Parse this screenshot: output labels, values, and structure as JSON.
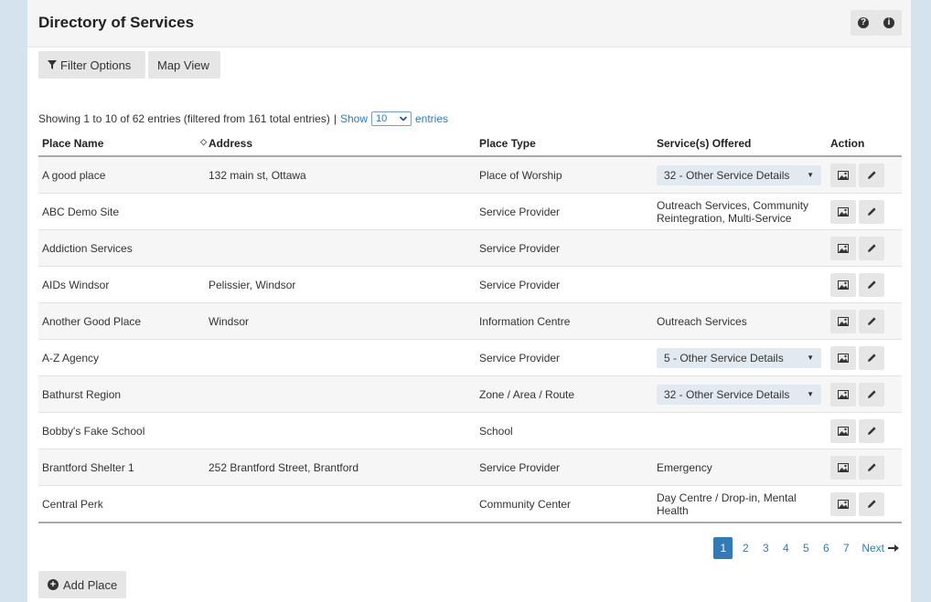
{
  "header": {
    "title": "Directory of Services",
    "help_glyph": "?",
    "info_glyph": "i"
  },
  "toolbar": {
    "filter_label": "Filter Options",
    "map_label": "Map View"
  },
  "summary": {
    "showing": "Showing 1 to 10 of 62 entries (filtered from 161 total entries)",
    "separator": "|",
    "show_label": "Show",
    "page_size": "10",
    "entries_label": "entries"
  },
  "table": {
    "columns": [
      "Place Name",
      "Address",
      "Place Type",
      "Service(s) Offered",
      "Action"
    ],
    "rows": [
      {
        "name": "A good place",
        "address": "132 main st, Ottawa",
        "type": "Place of Worship",
        "services": "32 - Other Service Details",
        "services_is_select": true
      },
      {
        "name": "ABC Demo Site",
        "address": "",
        "type": "Service Provider",
        "services": "Outreach Services, Community Reintegration, Multi-Service",
        "services_is_select": false
      },
      {
        "name": "Addiction Services",
        "address": "",
        "type": "Service Provider",
        "services": "",
        "services_is_select": false
      },
      {
        "name": "AIDs Windsor",
        "address": "Pelissier, Windsor",
        "type": "Service Provider",
        "services": "",
        "services_is_select": false
      },
      {
        "name": "Another Good Place",
        "address": "Windsor",
        "type": "Information Centre",
        "services": "Outreach Services",
        "services_is_select": false
      },
      {
        "name": "A-Z Agency",
        "address": "",
        "type": "Service Provider",
        "services": "5 - Other Service Details",
        "services_is_select": true
      },
      {
        "name": "Bathurst Region",
        "address": "",
        "type": "Zone / Area / Route",
        "services": "32 - Other Service Details",
        "services_is_select": true
      },
      {
        "name": "Bobby's Fake School",
        "address": "",
        "type": "School",
        "services": "",
        "services_is_select": false
      },
      {
        "name": "Brantford Shelter 1",
        "address": "252 Brantford Street, Brantford",
        "type": "Service Provider",
        "services": "Emergency",
        "services_is_select": false
      },
      {
        "name": "Central Perk",
        "address": "",
        "type": "Community Center",
        "services": "Day Centre / Drop-in, Mental Health",
        "services_is_select": false
      }
    ]
  },
  "pagination": {
    "pages": [
      "1",
      "2",
      "3",
      "4",
      "5",
      "6",
      "7"
    ],
    "current": "1",
    "next_label": "Next"
  },
  "add_place_label": "Add Place",
  "colors": {
    "accent": "#337ab7",
    "background": "#d5e3ef"
  }
}
